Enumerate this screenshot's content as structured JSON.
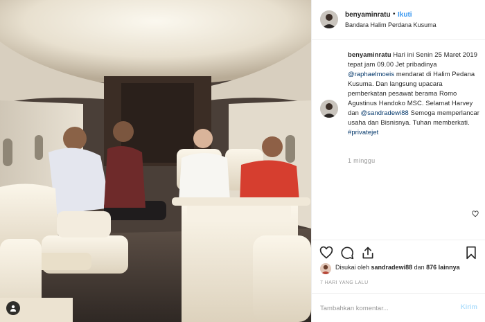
{
  "post": {
    "username": "benyaminratu",
    "separator": "•",
    "follow_label": "Ikuti",
    "location": "Bandara Halim Perdana Kusuma"
  },
  "caption": {
    "username": "benyaminratu",
    "text_1": "Hari ini Senin 25 Maret 2019 tepat jam 09.00 Jet pribadinya",
    "mention_1": "@raphaelmoeis",
    "text_2": "mendarat di Halim Pedana Kusuma. Dan langsung upacara pemberkatan pesawat berama Romo Agustinus Handoko MSC. Selamat Harvey dan",
    "mention_2": "@sandradewi88",
    "text_3": "Semoga memperlancar usaha dan Bisnisnya. Tuhan memberkati.",
    "hashtag": "#privatejet",
    "time": "1 minggu"
  },
  "likes": {
    "prefix": "Disukai oleh",
    "user": "sandradewi88",
    "middle": "dan",
    "count": "876 lainnya"
  },
  "date_label": "7 HARI YANG LALU",
  "comment_box": {
    "placeholder": "Tambahkan komentar...",
    "post_label": "Kirim"
  },
  "icons": {
    "user_tag": "user-tag-icon",
    "like": "heart-icon",
    "comment": "comment-icon",
    "share": "share-icon",
    "save": "bookmark-icon",
    "comment_like": "small-heart-icon"
  },
  "colors": {
    "link": "#3897f0",
    "mention": "#003569",
    "muted": "#999999",
    "post_disabled": "#b2dffc"
  }
}
